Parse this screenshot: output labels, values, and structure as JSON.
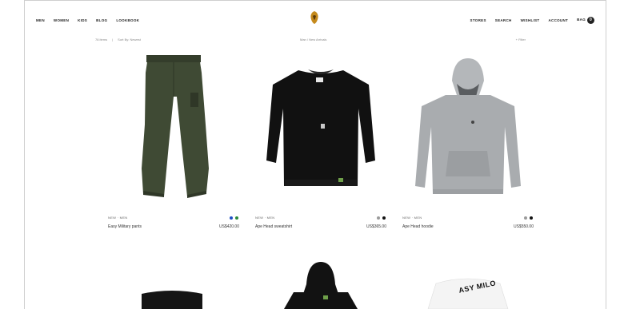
{
  "nav": {
    "left": [
      "MEN",
      "WOMEN",
      "KIDS",
      "BLOG",
      "LOOKBOOK"
    ],
    "right": [
      "STORES",
      "SEARCH",
      "WISHLIST",
      "ACCOUNT",
      "BAG"
    ],
    "bag_count": "0"
  },
  "toolbar": {
    "items": "78 items",
    "sort": "Sort By: Newest",
    "view": "Man / New Arrivals",
    "filter": "+ Filter"
  },
  "products": [
    {
      "meta": "NEW · MEN",
      "name": "Easy Military pants",
      "price": "US$420.00",
      "swatches": [
        "#1f4fc4",
        "#2c8a3a"
      ],
      "icon": "pants-image"
    },
    {
      "meta": "NEW · MEN",
      "name": "Ape Head sweatshirt",
      "price": "US$365.00",
      "swatches": [
        "#9a9a9a",
        "#111111"
      ],
      "icon": "sweatshirt-image"
    },
    {
      "meta": "NEW · MEN",
      "name": "Ape Head hoodie",
      "price": "US$550.00",
      "swatches": [
        "#9a9a9a",
        "#111111"
      ],
      "icon": "hoodie-image"
    }
  ],
  "row2": {
    "tee_text": "ASY MILO"
  }
}
